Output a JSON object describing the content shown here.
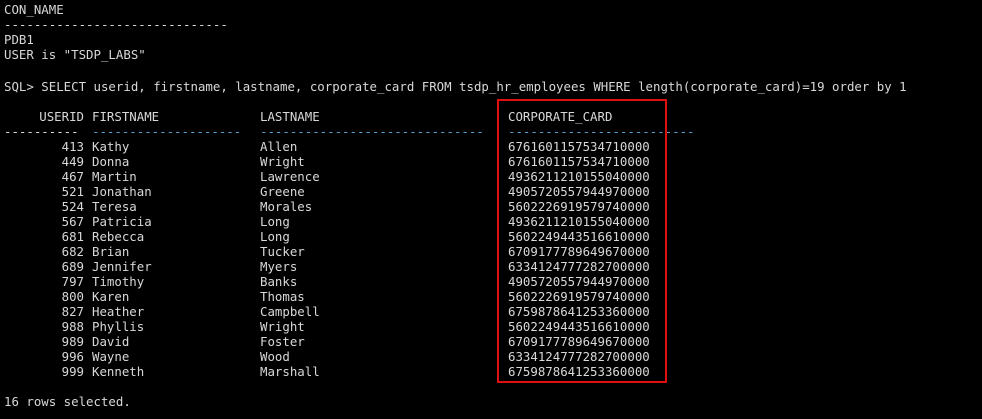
{
  "header": {
    "con_name_label": "CON_NAME",
    "con_name_underline": "------------------------------",
    "pdb": "PDB1",
    "user_line": "USER is \"TSDP_LABS\""
  },
  "query": {
    "prompt": "SQL> SELECT userid, firstname, lastname, corporate_card FROM tsdp_hr_employees WHERE length(corporate_card)=19 order by 1"
  },
  "table": {
    "columns": [
      "USERID",
      "FIRSTNAME",
      "LASTNAME",
      "CORPORATE_CARD"
    ],
    "separators": [
      "----------",
      "--------------------",
      "------------------------------",
      "-------------------------"
    ],
    "rows": [
      {
        "userid": "413",
        "firstname": "Kathy",
        "lastname": "Allen",
        "card": "6761601157534710000"
      },
      {
        "userid": "449",
        "firstname": "Donna",
        "lastname": "Wright",
        "card": "6761601157534710000"
      },
      {
        "userid": "467",
        "firstname": "Martin",
        "lastname": "Lawrence",
        "card": "4936211210155040000"
      },
      {
        "userid": "521",
        "firstname": "Jonathan",
        "lastname": "Greene",
        "card": "4905720557944970000"
      },
      {
        "userid": "524",
        "firstname": "Teresa",
        "lastname": "Morales",
        "card": "5602226919579740000"
      },
      {
        "userid": "567",
        "firstname": "Patricia",
        "lastname": "Long",
        "card": "4936211210155040000"
      },
      {
        "userid": "681",
        "firstname": "Rebecca",
        "lastname": "Long",
        "card": "5602249443516610000"
      },
      {
        "userid": "682",
        "firstname": "Brian",
        "lastname": "Tucker",
        "card": "6709177789649670000"
      },
      {
        "userid": "689",
        "firstname": "Jennifer",
        "lastname": "Myers",
        "card": "6334124777282700000"
      },
      {
        "userid": "797",
        "firstname": "Timothy",
        "lastname": "Banks",
        "card": "4905720557944970000"
      },
      {
        "userid": "800",
        "firstname": "Karen",
        "lastname": "Thomas",
        "card": "5602226919579740000"
      },
      {
        "userid": "827",
        "firstname": "Heather",
        "lastname": "Campbell",
        "card": "6759878641253360000"
      },
      {
        "userid": "988",
        "firstname": "Phyllis",
        "lastname": "Wright",
        "card": "5602249443516610000"
      },
      {
        "userid": "989",
        "firstname": "David",
        "lastname": "Foster",
        "card": "6709177789649670000"
      },
      {
        "userid": "996",
        "firstname": "Wayne",
        "lastname": "Wood",
        "card": "6334124777282700000"
      },
      {
        "userid": "999",
        "firstname": "Kenneth",
        "lastname": "Marshall",
        "card": "6759878641253360000"
      }
    ]
  },
  "footer": {
    "rows_selected": "16 rows selected."
  },
  "colors": {
    "background": "#000000",
    "text": "#d8d8d8",
    "highlight": "#e01010",
    "separator_accent": "#5aa0d0"
  }
}
